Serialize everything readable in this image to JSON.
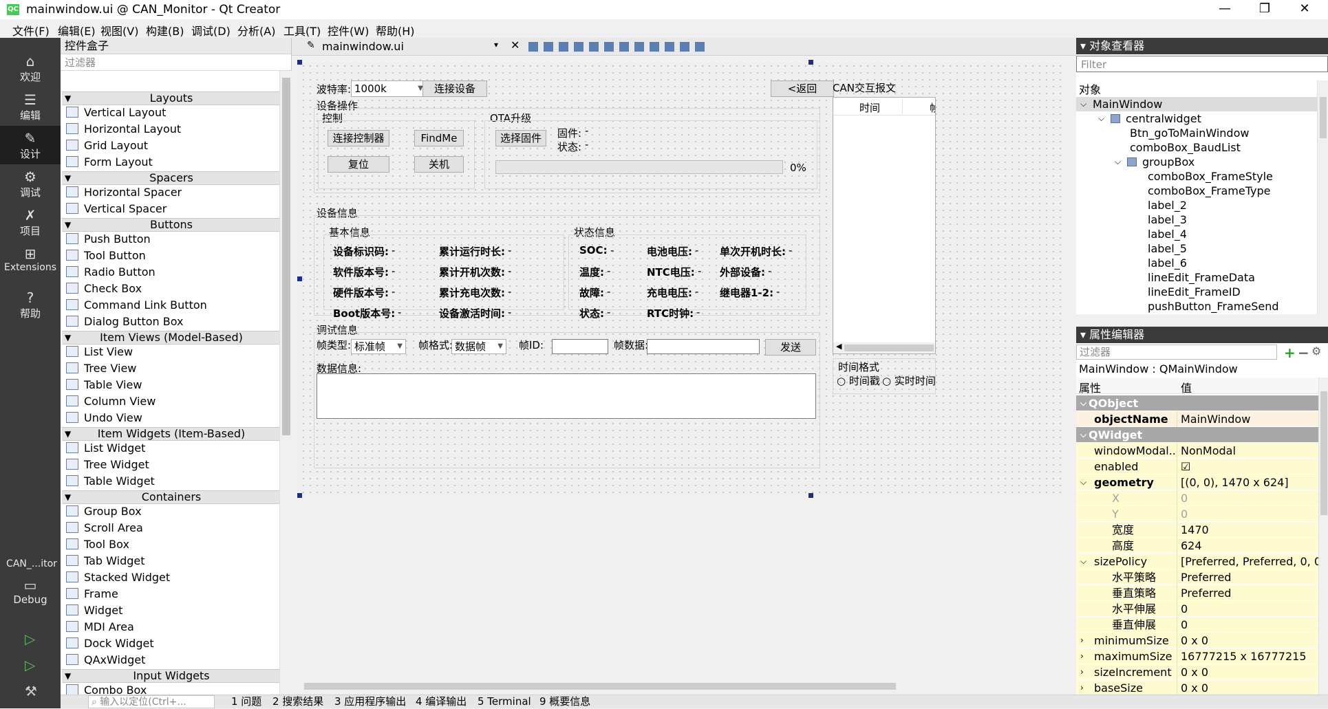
{
  "window": {
    "title": "mainwindow.ui @ CAN_Monitor - Qt Creator",
    "logo": "QC",
    "min": "—",
    "max": "❐",
    "close": "✕"
  },
  "menu": [
    "文件(F)",
    "编辑(E)",
    "视图(V)",
    "构建(B)",
    "调试(D)",
    "分析(A)",
    "工具(T)",
    "控件(W)",
    "帮助(H)"
  ],
  "modes": [
    {
      "label": "欢迎",
      "icon": "home-icon"
    },
    {
      "label": "编辑",
      "icon": "edit-icon"
    },
    {
      "label": "设计",
      "icon": "design-icon"
    },
    {
      "label": "调试",
      "icon": "debug-icon"
    },
    {
      "label": "项目",
      "icon": "wrench-icon"
    },
    {
      "label": "Extensions",
      "icon": "extensions-icon"
    },
    {
      "label": "帮助",
      "icon": "help-icon"
    }
  ],
  "kit": {
    "project": "CAN_...itor",
    "build": "Debug"
  },
  "widgetbox": {
    "title": "控件盒子",
    "filter_placeholder": "过滤器",
    "categories": {
      "layouts": "Layouts",
      "spacers": "Spacers",
      "buttons": "Buttons",
      "item_views": "Item Views (Model-Based)",
      "item_widgets": "Item Widgets (Item-Based)",
      "containers": "Containers",
      "input_widgets": "Input Widgets"
    },
    "items": {
      "layouts": [
        "Vertical Layout",
        "Horizontal Layout",
        "Grid Layout",
        "Form Layout"
      ],
      "spacers": [
        "Horizontal Spacer",
        "Vertical Spacer"
      ],
      "buttons": [
        "Push Button",
        "Tool Button",
        "Radio Button",
        "Check Box",
        "Command Link Button",
        "Dialog Button Box"
      ],
      "item_views": [
        "List View",
        "Tree View",
        "Table View",
        "Column View",
        "Undo View"
      ],
      "item_widgets": [
        "List Widget",
        "Tree Widget",
        "Table Widget"
      ],
      "containers": [
        "Group Box",
        "Scroll Area",
        "Tool Box",
        "Tab Widget",
        "Stacked Widget",
        "Frame",
        "Widget",
        "MDI Area",
        "Dock Widget",
        "QAxWidget"
      ],
      "input_widgets": [
        "Combo Box"
      ]
    }
  },
  "editor": {
    "file": "mainwindow.ui"
  },
  "form": {
    "baud_label": "波特率:",
    "baud_value": "1000k",
    "connect_device": "连接设备",
    "back": "<返回",
    "device_ops": "设备操作",
    "control": "控制",
    "connect_controller": "连接控制器",
    "findme": "FindMe",
    "reset": "复位",
    "shutdown": "关机",
    "ota": "OTA升级",
    "select_fw": "选择固件",
    "firmware": "固件:",
    "firmware_val": "-",
    "status": "状态:",
    "status_val": "-",
    "progress": "0%",
    "device_info": "设备信息",
    "basic_info": "基本信息",
    "state_info": "状态信息",
    "basic": [
      [
        "设备标识码:",
        "-"
      ],
      [
        "累计运行时长:",
        "-"
      ],
      [
        "软件版本号:",
        "-"
      ],
      [
        "累计开机次数:",
        "-"
      ],
      [
        "硬件版本号:",
        "-"
      ],
      [
        "累计充电次数:",
        "-"
      ],
      [
        "Boot版本号:",
        "-"
      ],
      [
        "设备激活时间:",
        "-"
      ]
    ],
    "state": [
      [
        "SOC:",
        "-"
      ],
      [
        "电池电压:",
        "-"
      ],
      [
        "单次开机时长:",
        "-"
      ],
      [
        "温度:",
        "-"
      ],
      [
        "NTC电压:",
        "-"
      ],
      [
        "外部设备:",
        "-"
      ],
      [
        "故障:",
        "-"
      ],
      [
        "充电电压:",
        "-"
      ],
      [
        "继电器1-2:",
        "-"
      ],
      [
        "状态:",
        "-"
      ],
      [
        "RTC时钟:",
        "-"
      ]
    ],
    "debug_info": "调试信息",
    "frame_type_label": "帧类型:",
    "frame_type": "标准帧",
    "frame_format_label": "帧格式:",
    "frame_format": "数据帧",
    "frame_id_label": "帧ID:",
    "frame_data_label": "帧数据:",
    "send": "发送",
    "data_info": "数据信息:",
    "can_title": "CAN交互报文",
    "can_col_time": "时间",
    "can_col_frame": "帧",
    "time_format": "时间格式",
    "timestamp": "时间戳",
    "realtime": "实时时间"
  },
  "object_inspector": {
    "title": "对象查看器",
    "filter_placeholder": "Filter",
    "header": "对象",
    "tree": [
      {
        "name": "MainWindow",
        "level": 0,
        "selected": true
      },
      {
        "name": "centralwidget",
        "level": 1
      },
      {
        "name": "Btn_goToMainWindow",
        "level": 2
      },
      {
        "name": "comboBox_BaudList",
        "level": 2
      },
      {
        "name": "groupBox",
        "level": 2
      },
      {
        "name": "comboBox_FrameStyle",
        "level": 3
      },
      {
        "name": "comboBox_FrameType",
        "level": 3
      },
      {
        "name": "label_2",
        "level": 3
      },
      {
        "name": "label_3",
        "level": 3
      },
      {
        "name": "label_4",
        "level": 3
      },
      {
        "name": "label_5",
        "level": 3
      },
      {
        "name": "label_6",
        "level": 3
      },
      {
        "name": "lineEdit_FrameData",
        "level": 3
      },
      {
        "name": "lineEdit_FrameID",
        "level": 3
      },
      {
        "name": "pushButton_FrameSend",
        "level": 3
      }
    ]
  },
  "property_editor": {
    "title": "属性编辑器",
    "filter_placeholder": "过滤器",
    "context": "MainWindow : QMainWindow",
    "col_prop": "属性",
    "col_val": "值",
    "rows": [
      {
        "k": "QObject",
        "v": "",
        "t": "sec"
      },
      {
        "k": "objectName",
        "v": "MainWindow",
        "t": "bold"
      },
      {
        "k": "QWidget",
        "v": "",
        "t": "sec"
      },
      {
        "k": "windowModal...",
        "v": "NonModal",
        "t": "y"
      },
      {
        "k": "enabled",
        "v": "☑",
        "t": "y"
      },
      {
        "k": "geometry",
        "v": "[(0, 0), 1470 x 624]",
        "t": "ybold"
      },
      {
        "k": "X",
        "v": "0",
        "t": "sub gray"
      },
      {
        "k": "Y",
        "v": "0",
        "t": "sub gray"
      },
      {
        "k": "宽度",
        "v": "1470",
        "t": "sub"
      },
      {
        "k": "高度",
        "v": "624",
        "t": "sub"
      },
      {
        "k": "sizePolicy",
        "v": "[Preferred, Preferred, 0, 0]",
        "t": "y"
      },
      {
        "k": "水平策略",
        "v": "Preferred",
        "t": "sub"
      },
      {
        "k": "垂直策略",
        "v": "Preferred",
        "t": "sub"
      },
      {
        "k": "水平伸展",
        "v": "0",
        "t": "sub"
      },
      {
        "k": "垂直伸展",
        "v": "0",
        "t": "sub"
      },
      {
        "k": "minimumSize",
        "v": "0 x 0",
        "t": "y"
      },
      {
        "k": "maximumSize",
        "v": "16777215 x 16777215",
        "t": "y"
      },
      {
        "k": "sizeIncrement",
        "v": "0 x 0",
        "t": "y"
      },
      {
        "k": "baseSize",
        "v": "0 x 0",
        "t": "y"
      }
    ]
  },
  "statusbar": {
    "locator_placeholder": "输入以定位(Ctrl+...",
    "tabs": [
      "1 问题",
      "2 搜索结果",
      "3 应用程序输出",
      "4 编译输出",
      "5 Terminal",
      "9 概要信息"
    ]
  }
}
